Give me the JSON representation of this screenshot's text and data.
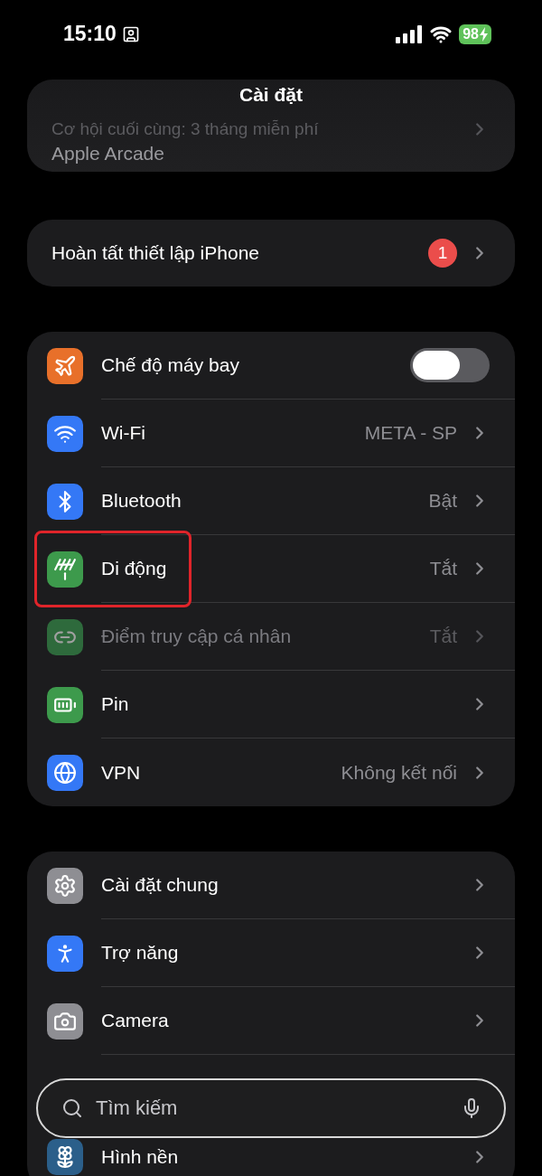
{
  "status_bar": {
    "time": "15:10",
    "battery": "98",
    "charging": true
  },
  "title": "Cài đặt",
  "promo": {
    "headline": "Cơ hội cuối cùng: 3 tháng miễn phí",
    "label": "Apple Arcade"
  },
  "setup": {
    "label": "Hoàn tất thiết lập iPhone",
    "badge": "1"
  },
  "groups": [
    {
      "rows": [
        {
          "kind": "toggle",
          "label": "Chế độ máy bay",
          "color": "#e8702a",
          "on": false,
          "disabled": false,
          "highlighted": false
        },
        {
          "kind": "link",
          "label": "Wi-Fi",
          "value": "META - SP",
          "color": "#3478f6",
          "disabled": false,
          "highlighted": false
        },
        {
          "kind": "link",
          "label": "Bluetooth",
          "value": "Bật",
          "color": "#3478f6",
          "disabled": false,
          "highlighted": false
        },
        {
          "kind": "link",
          "label": "Di động",
          "value": "Tắt",
          "color": "#3d9a4c",
          "disabled": false,
          "highlighted": true
        },
        {
          "kind": "link",
          "label": "Điểm truy cập cá nhân",
          "value": "Tắt",
          "color": "#2e6a3c",
          "disabled": true,
          "highlighted": false
        },
        {
          "kind": "link",
          "label": "Pin",
          "color": "#3d9a4c",
          "disabled": false,
          "highlighted": false
        },
        {
          "kind": "link",
          "label": "VPN",
          "value": "Không kết nối",
          "color": "#3478f6",
          "disabled": false,
          "highlighted": false
        }
      ]
    },
    {
      "rows": [
        {
          "kind": "link",
          "label": "Cài đặt chung",
          "color": "#8e8e93",
          "disabled": false,
          "highlighted": false
        },
        {
          "kind": "link",
          "label": "Trợ năng",
          "color": "#3478f6",
          "disabled": false,
          "highlighted": false
        },
        {
          "kind": "link",
          "label": "Camera",
          "color": "#8e8e93",
          "disabled": false,
          "highlighted": false
        },
        {
          "kind": "link",
          "label": "Hình nền",
          "color": "#2b5f8a",
          "disabled": false,
          "highlighted": false
        }
      ]
    }
  ],
  "search": {
    "placeholder": "Tìm kiếm"
  }
}
